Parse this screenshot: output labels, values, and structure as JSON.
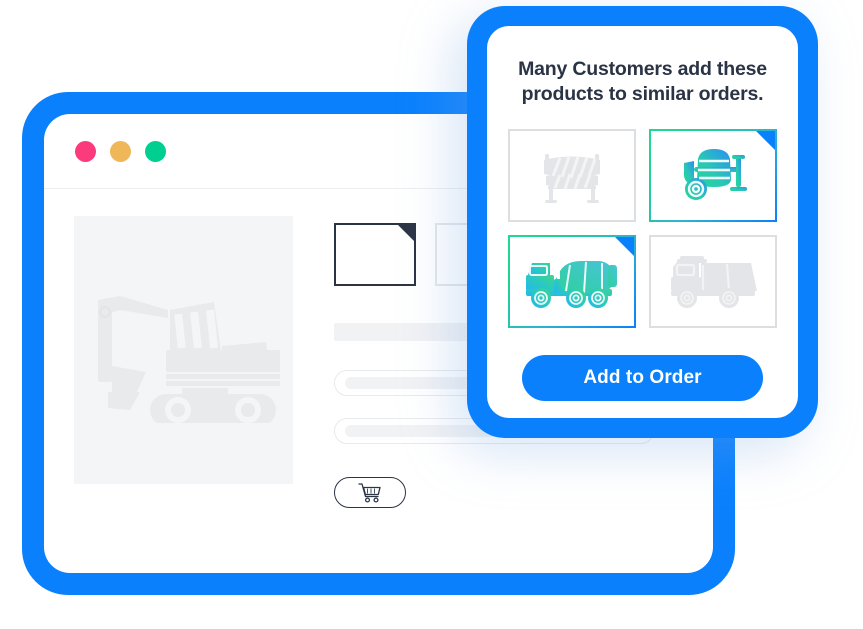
{
  "theme": {
    "accent_blue": "#0b80fd",
    "gradient_green": "#1fd995",
    "gradient_blue": "#0b80fd",
    "ink": "#2b3445",
    "placeholder_gray": "#dcdfe2",
    "skeleton_gray": "#f1f2f4"
  },
  "browser_window": {
    "name": "product-detail-window",
    "traffic_lights": [
      {
        "name": "close-dot",
        "color": "#fb3b7c"
      },
      {
        "name": "minimize-dot",
        "color": "#efb košt"
      },
      {
        "name": "maximize-dot",
        "color": "#00cf91"
      }
    ],
    "traffic_light_colors": [
      "#fb3b7c",
      "#efb757",
      "#00cf91"
    ],
    "hero_image": {
      "icon": "excavator-icon",
      "alt_label": "Excavator product image placeholder"
    },
    "thumbnails": [
      {
        "name": "thumbnail-1",
        "state": "selected",
        "icon": "product-thumbnail-icon"
      },
      {
        "name": "thumbnail-2",
        "state": "default",
        "icon": "product-thumbnail-icon"
      }
    ],
    "skeleton": {
      "title_placeholder": "",
      "line_one_placeholder": "",
      "line_two_placeholder": ""
    },
    "cart_button": {
      "icon": "shopping-cart-icon",
      "label": ""
    }
  },
  "popup": {
    "name": "recommended-products-popup",
    "heading": "Many Customers add these products to similar orders.",
    "products": [
      {
        "name": "product-card-road-barrier",
        "icon": "road-barrier-icon",
        "label": "",
        "selected": false
      },
      {
        "name": "product-card-concrete-mixer",
        "icon": "concrete-mixer-icon",
        "label": "",
        "selected": true
      },
      {
        "name": "product-card-mixer-truck",
        "icon": "mixer-truck-icon",
        "label": "",
        "selected": true
      },
      {
        "name": "product-card-dump-truck",
        "icon": "dump-truck-icon",
        "label": "",
        "selected": false
      }
    ],
    "add_to_order_label": "Add to Order"
  }
}
